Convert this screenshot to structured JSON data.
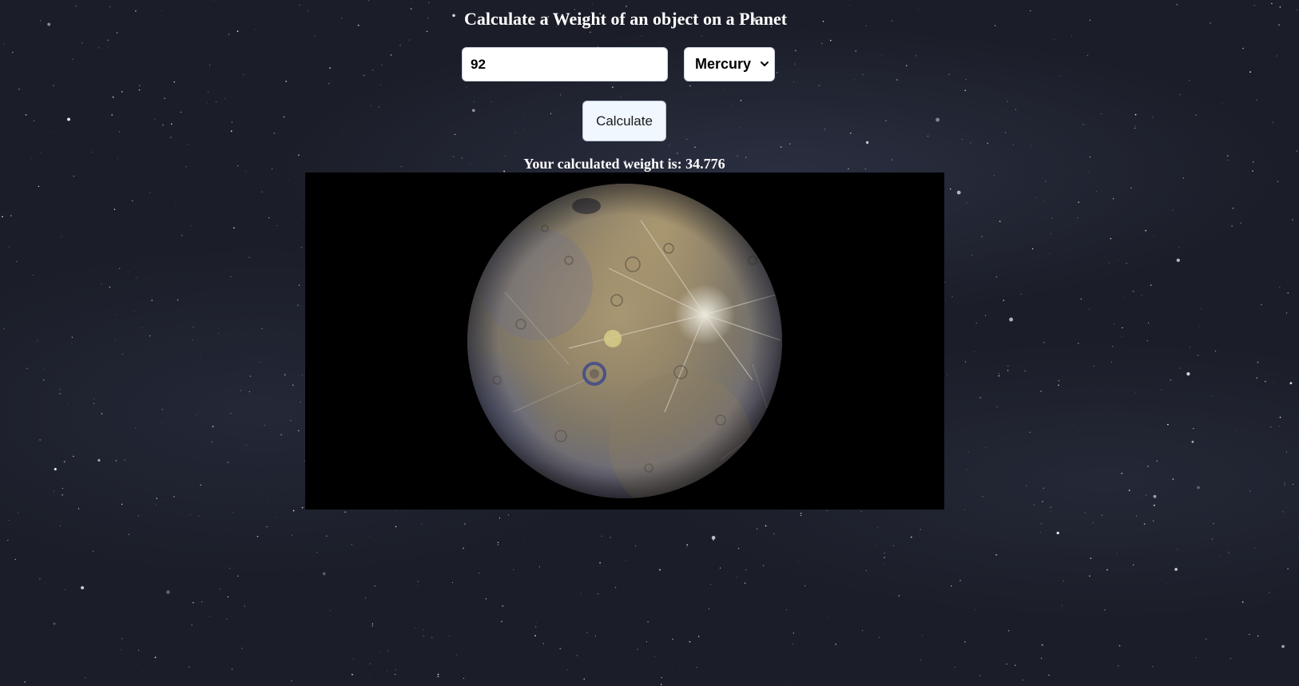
{
  "page": {
    "title": "Calculate a Weight of an object on a Planet"
  },
  "form": {
    "weight_value": "92",
    "planet_selected": "Mercury",
    "calculate_label": "Calculate"
  },
  "result": {
    "text": "Your calculated weight is: 34.776"
  },
  "planet_image": {
    "planet": "Mercury",
    "background_color": "#000000"
  },
  "colors": {
    "page_background": "#1b1e28",
    "button_background": "#f0f7ff",
    "text": "#ffffff"
  }
}
